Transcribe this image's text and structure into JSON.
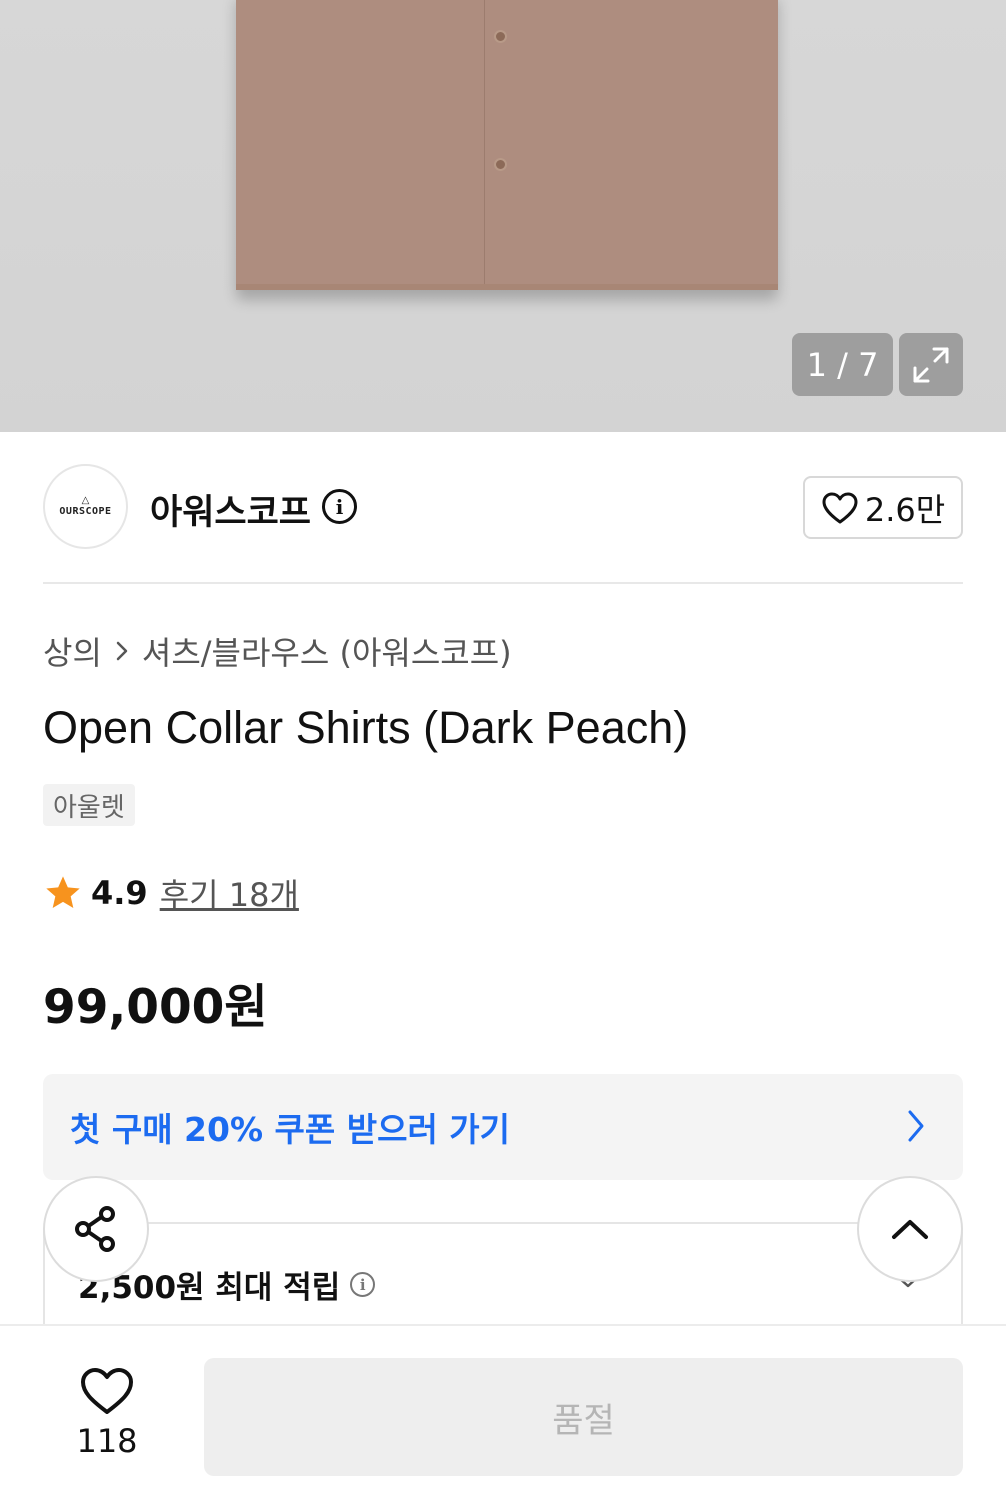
{
  "gallery": {
    "counter": "1 / 7",
    "expand_icon": "expand-icon"
  },
  "brand": {
    "logo_text": "OURSCOPE",
    "name": "아워스코프",
    "info_icon": "info-icon",
    "likes": "2.6만"
  },
  "breadcrumb": {
    "category": "상의",
    "separator_icon": "chevron-right-icon",
    "subcategory": "셔츠/블라우스 (아워스코프)"
  },
  "product": {
    "title": "Open Collar Shirts (Dark Peach)",
    "tag": "아울렛",
    "rating": "4.9",
    "reviews": "후기 18개",
    "price": "99,000원"
  },
  "coupon": {
    "label": "첫 구매 20% 쿠폰 받으러 가기"
  },
  "points": {
    "label": "2,500원 최대 적립"
  },
  "bottom_bar": {
    "wish_count": "118",
    "soldout_label": "품절"
  },
  "colors": {
    "accent_blue": "#1c6bf0",
    "star": "#f7931e",
    "shirt": "#ae8d7f"
  }
}
